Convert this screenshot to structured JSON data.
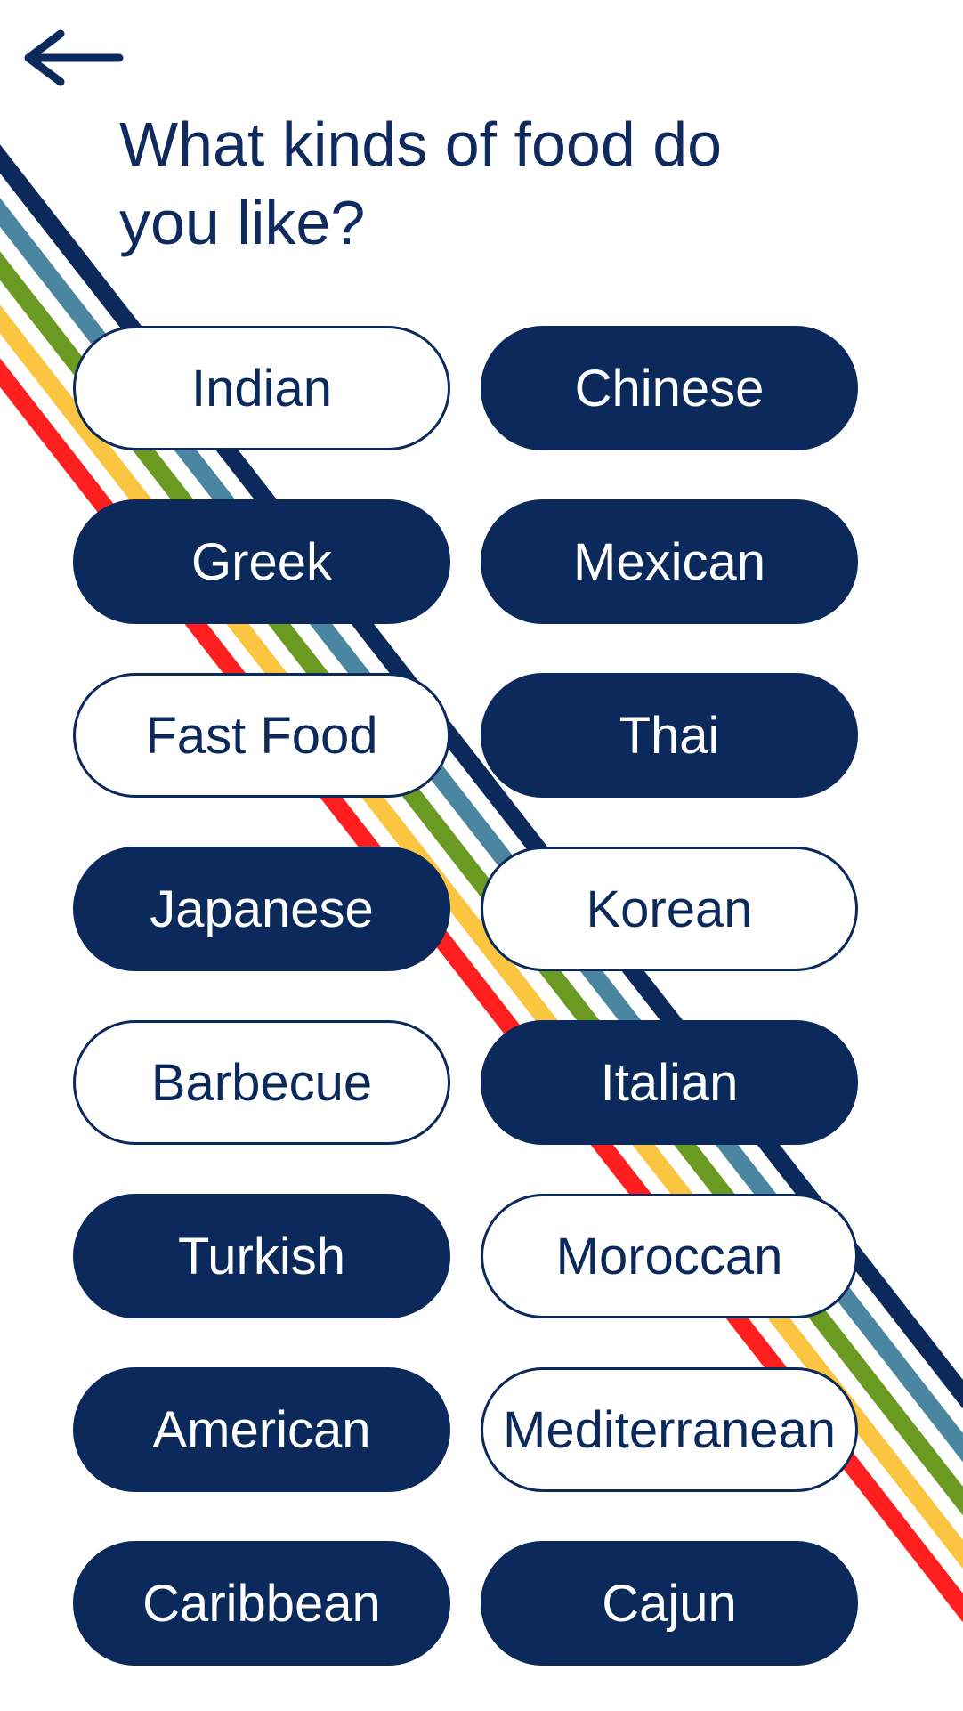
{
  "header": {
    "title": "What kinds of food do you like?"
  },
  "back": {
    "icon": "arrow-left-icon"
  },
  "theme": {
    "navy": "#0b295a",
    "stripe_colors": [
      "#0b295a",
      "#4a86a0",
      "#6a9a22",
      "#fbc441",
      "#ff1f1f"
    ]
  },
  "cuisines": [
    {
      "label": "Indian",
      "selected": false
    },
    {
      "label": "Chinese",
      "selected": true
    },
    {
      "label": "Greek",
      "selected": true
    },
    {
      "label": "Mexican",
      "selected": true
    },
    {
      "label": "Fast Food",
      "selected": false
    },
    {
      "label": "Thai",
      "selected": true
    },
    {
      "label": "Japanese",
      "selected": true
    },
    {
      "label": "Korean",
      "selected": false
    },
    {
      "label": "Barbecue",
      "selected": false
    },
    {
      "label": "Italian",
      "selected": true
    },
    {
      "label": "Turkish",
      "selected": true
    },
    {
      "label": "Moroccan",
      "selected": false
    },
    {
      "label": "American",
      "selected": true
    },
    {
      "label": "Mediterranean",
      "selected": false
    },
    {
      "label": "Caribbean",
      "selected": true
    },
    {
      "label": "Cajun",
      "selected": true
    }
  ]
}
